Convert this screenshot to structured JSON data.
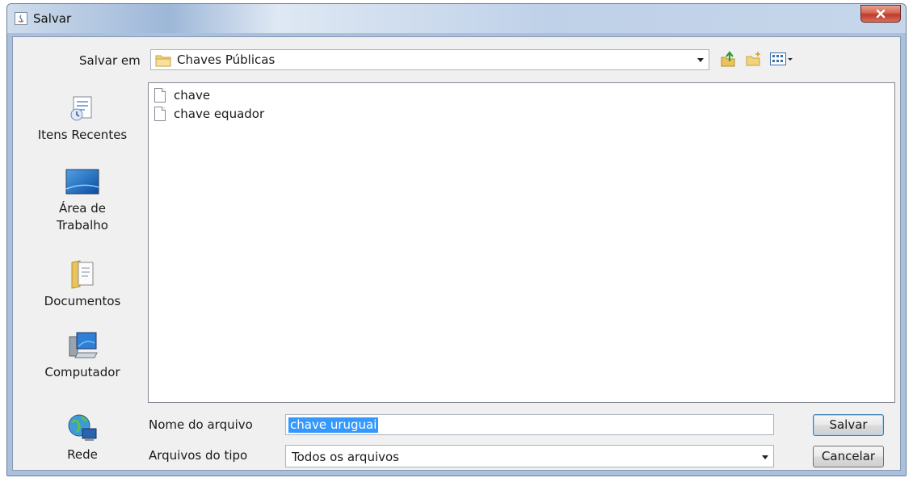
{
  "window": {
    "title": "Salvar",
    "close_label": "×"
  },
  "toolbar": {
    "look_in_label": "Salvar em",
    "look_in_value": "Chaves Públicas",
    "icons": [
      "up-one-level-icon",
      "new-folder-icon",
      "view-menu-icon"
    ]
  },
  "places": [
    {
      "label": "Itens Recentes",
      "icon": "recent-items-icon"
    },
    {
      "label": "Área de Trabalho",
      "icon": "desktop-icon"
    },
    {
      "label": "Documentos",
      "icon": "documents-icon"
    },
    {
      "label": "Computador",
      "icon": "computer-icon"
    },
    {
      "label": "Rede",
      "icon": "network-icon"
    }
  ],
  "files": [
    {
      "name": "chave"
    },
    {
      "name": "chave equador"
    }
  ],
  "form": {
    "file_name_label": "Nome do arquivo",
    "file_name_value": "chave uruguai",
    "file_type_label": "Arquivos do tipo",
    "file_type_value": "Todos os arquivos"
  },
  "buttons": {
    "save_label": "Salvar",
    "cancel_label": "Cancelar"
  },
  "colors": {
    "selection": "#3399ff",
    "close_button": "#c0392b",
    "title_bar": "#bcd0e8"
  }
}
